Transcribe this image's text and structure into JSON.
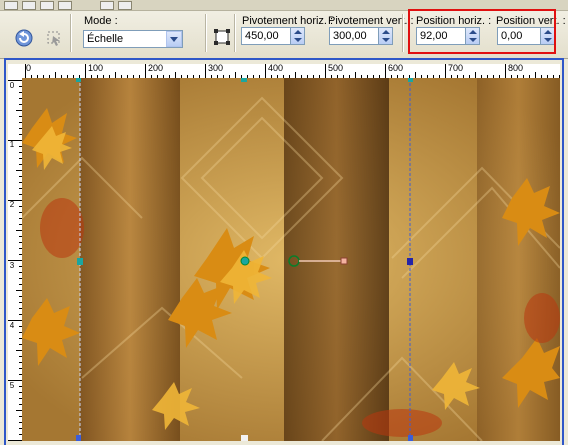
{
  "toolbar": {
    "mode_label": "Mode :",
    "mode_value": "Échelle",
    "pivot_h_label": "Pivotement horiz. :",
    "pivot_h_value": "450,00",
    "pivot_v_label": "Pivotement vert. :",
    "pivot_v_value": "300,00",
    "pos_h_label": "Position horiz. :",
    "pos_h_value": "92,00",
    "pos_v_label": "Position vert. :",
    "pos_v_value": "0,00"
  },
  "ruler": {
    "h_labels": [
      "0",
      "100",
      "200",
      "300",
      "400",
      "500",
      "600",
      "700",
      "800"
    ],
    "v_labels": [
      "0",
      "1",
      "2",
      "3",
      "4",
      "5"
    ]
  },
  "colors": {
    "highlight": "#e01010",
    "frame": "#2f57c8",
    "handle": "#1aa6a0"
  },
  "icons": [
    "reset-icon",
    "pick-tool-icon",
    "fit-image-icon"
  ]
}
